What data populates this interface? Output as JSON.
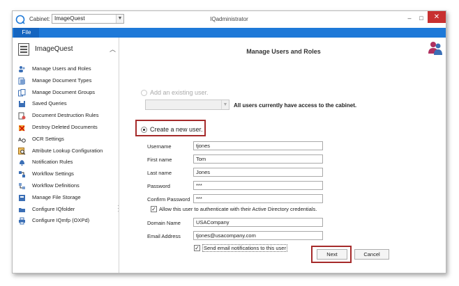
{
  "titlebar": {
    "cabinet_label": "Cabinet:",
    "cabinet_value": "ImageQuest",
    "app_title": "IQadministrator",
    "minimize": "–",
    "maximize": "□",
    "close": "✕"
  },
  "ribbon": {
    "file_tab": "File"
  },
  "sidebar": {
    "title": "ImageQuest",
    "items": [
      {
        "label": "Manage Users and Roles"
      },
      {
        "label": "Manage Document Types"
      },
      {
        "label": "Manage Document Groups"
      },
      {
        "label": "Saved Queries"
      },
      {
        "label": "Document Destruction Rules"
      },
      {
        "label": "Destroy Deleted Documents"
      },
      {
        "label": "OCR Settings"
      },
      {
        "label": "Attribute Lookup Configuration"
      },
      {
        "label": "Notification Rules"
      },
      {
        "label": "Workflow Settings"
      },
      {
        "label": "Workflow Definitions"
      },
      {
        "label": "Manage File Storage"
      },
      {
        "label": "Configure IQfolder"
      },
      {
        "label": "Configure IQmfp (OXPd)"
      }
    ]
  },
  "panel": {
    "title": "Manage Users and Roles",
    "add_existing_label": "Add an existing user.",
    "access_note": "All users currently have access to the cabinet.",
    "create_new_label": "Create a new user.",
    "form": {
      "username_label": "Username",
      "username_value": "tjones",
      "firstname_label": "First name",
      "firstname_value": "Tom",
      "lastname_label": "Last name",
      "lastname_value": "Jones",
      "password_label": "Password",
      "password_value": "***",
      "confirm_label": "Confirm Password",
      "confirm_value": "***",
      "ad_auth_label": "Allow this user to authenticate with their Active Directory credentials.",
      "domain_label": "Domain Name",
      "domain_value": "USACompany",
      "email_label": "Email Address",
      "email_value": "tjones@usacompany.com",
      "notify_label": "Send email notifications to this user"
    },
    "next_button": "Next",
    "cancel_button": "Cancel"
  },
  "colors": {
    "ribbon": "#1e79d8",
    "highlight": "#a52a2a",
    "close": "#c83131"
  }
}
